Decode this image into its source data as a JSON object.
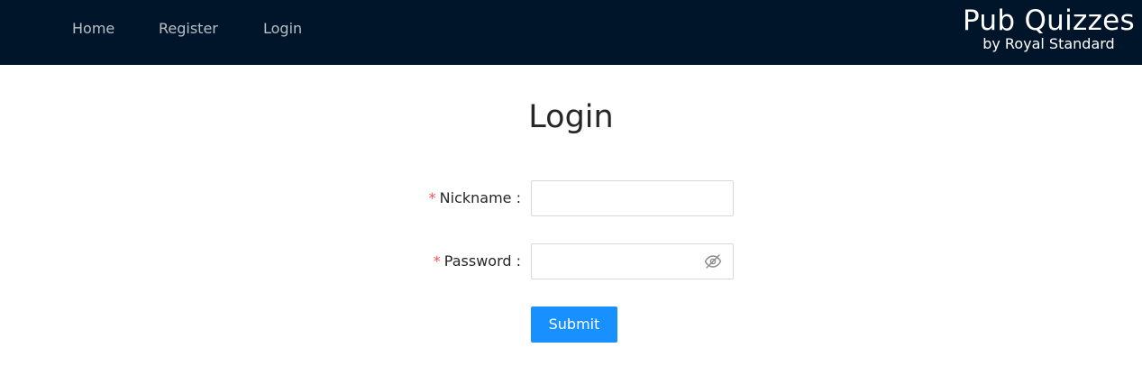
{
  "nav": {
    "items": [
      {
        "label": "Home"
      },
      {
        "label": "Register"
      },
      {
        "label": "Login"
      }
    ],
    "background": "#001529"
  },
  "brand": {
    "title": "Pub Quizzes",
    "subtitle": "by Royal Standard"
  },
  "page": {
    "title": "Login"
  },
  "form": {
    "required_mark": "*",
    "nickname": {
      "label": "Nickname :",
      "value": "",
      "placeholder": ""
    },
    "password": {
      "label": "Password :",
      "value": "",
      "placeholder": "",
      "toggle_icon": "eye-invisible-icon"
    },
    "submit_label": "Submit",
    "accent": "#1890ff",
    "required_color": "#ff4d4f"
  }
}
